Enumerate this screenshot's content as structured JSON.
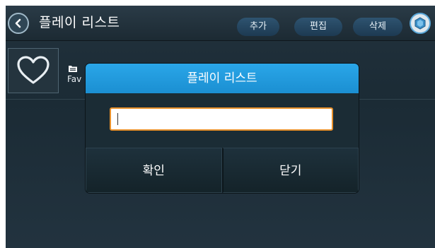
{
  "header": {
    "title": "플레이 리스트",
    "back_icon": "chevron-left-icon",
    "app_icon": "app-logo-icon"
  },
  "toolbar": {
    "add_label": "추가",
    "edit_label": "편집",
    "delete_label": "삭제"
  },
  "list": {
    "items": [
      {
        "label": "Favorites",
        "visible_label": "Fav",
        "icon": "heart-icon",
        "type_icon": "folder-icon"
      }
    ]
  },
  "dialog": {
    "title": "플레이 리스트",
    "input_value": "",
    "confirm_label": "확인",
    "close_label": "닫기"
  },
  "colors": {
    "accent": "#1f9ae0",
    "input_border": "#e8902a",
    "background": "#1e2f39"
  }
}
